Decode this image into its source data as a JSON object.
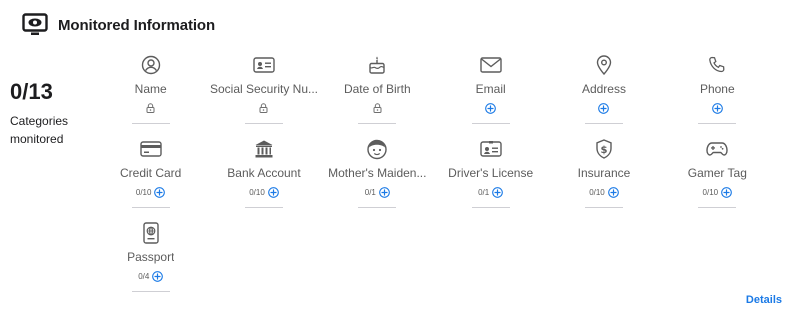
{
  "header": {
    "title": "Monitored Information",
    "icon": "monitor-eye-icon"
  },
  "summary": {
    "count": "0/13",
    "label": "Categories monitored"
  },
  "categories": [
    {
      "label": "Name",
      "icon": "person-circle-icon",
      "meta": "",
      "state": "locked"
    },
    {
      "label": "Social Security Nu...",
      "icon": "id-card-icon",
      "meta": "",
      "state": "locked"
    },
    {
      "label": "Date of Birth",
      "icon": "birthday-cake-icon",
      "meta": "",
      "state": "locked"
    },
    {
      "label": "Email",
      "icon": "envelope-icon",
      "meta": "",
      "state": "add"
    },
    {
      "label": "Address",
      "icon": "location-pin-icon",
      "meta": "",
      "state": "add"
    },
    {
      "label": "Phone",
      "icon": "phone-icon",
      "meta": "",
      "state": "add"
    },
    {
      "label": "Credit Card",
      "icon": "credit-card-icon",
      "meta": "0/10",
      "state": "add"
    },
    {
      "label": "Bank Account",
      "icon": "bank-icon",
      "meta": "0/10",
      "state": "add"
    },
    {
      "label": "Mother's Maiden...",
      "icon": "face-icon",
      "meta": "0/1",
      "state": "add"
    },
    {
      "label": "Driver's License",
      "icon": "license-card-icon",
      "meta": "0/1",
      "state": "add"
    },
    {
      "label": "Insurance",
      "icon": "shield-dollar-icon",
      "meta": "0/10",
      "state": "add"
    },
    {
      "label": "Gamer Tag",
      "icon": "gamepad-icon",
      "meta": "0/10",
      "state": "add"
    },
    {
      "label": "Passport",
      "icon": "passport-icon",
      "meta": "0/4",
      "state": "add"
    }
  ],
  "footer": {
    "details_label": "Details"
  },
  "colors": {
    "accent": "#1b7ae6",
    "icon": "#5c5c5c",
    "divider": "#cfcfd4"
  }
}
